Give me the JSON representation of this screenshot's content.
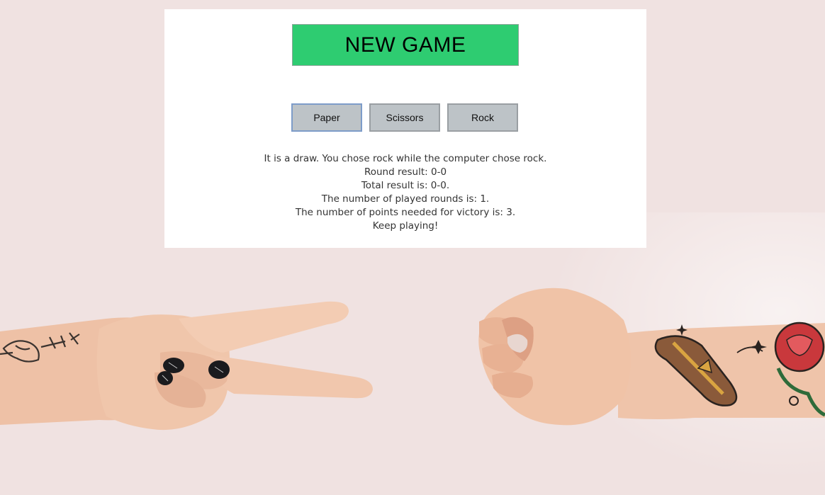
{
  "new_game_label": "NEW GAME",
  "choices": [
    {
      "label": "Paper"
    },
    {
      "label": "Scissors"
    },
    {
      "label": "Rock"
    }
  ],
  "messages": {
    "result": "It is a draw. You chose rock while the computer chose rock.",
    "round_result": "Round result: 0-0",
    "total_result": "Total result is: 0-0.",
    "played_rounds": "The number of played rounds is: 1.",
    "points_needed": "The number of points needed for victory is: 3.",
    "status": "Keep playing!"
  },
  "colors": {
    "background": "#f0e2e1",
    "panel": "#ffffff",
    "new_game_button": "#2ecc71",
    "choice_button": "#bdc3c7"
  },
  "icons": {
    "left_hand": "scissors-hand-icon",
    "right_hand": "rock-fist-icon"
  }
}
